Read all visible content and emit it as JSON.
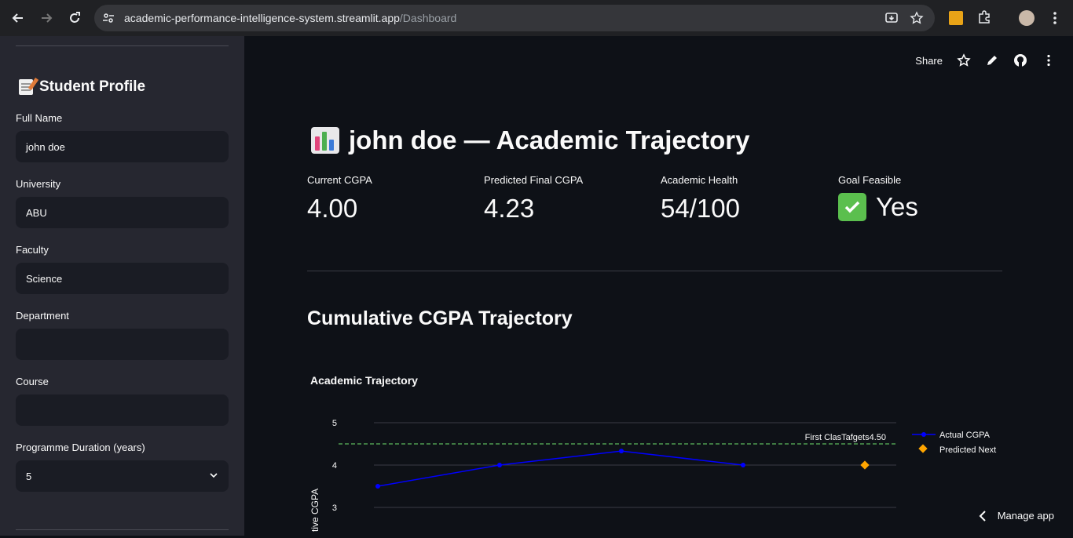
{
  "browser": {
    "url_host": "academic-performance-intelligence-system.streamlit.app",
    "url_path": "/Dashboard"
  },
  "sidebar": {
    "title": "Student Profile",
    "fields": [
      {
        "label": "Full Name",
        "value": "john doe"
      },
      {
        "label": "University",
        "value": "ABU"
      },
      {
        "label": "Faculty",
        "value": "Science"
      },
      {
        "label": "Department",
        "value": ""
      },
      {
        "label": "Course",
        "value": ""
      },
      {
        "label": "Programme Duration (years)",
        "value": "5"
      }
    ]
  },
  "toolbar": {
    "share_label": "Share"
  },
  "page": {
    "title": "john doe — Academic Trajectory",
    "section_title": "Cumulative CGPA Trajectory",
    "manage_label": "Manage app"
  },
  "metrics": [
    {
      "label": "Current CGPA",
      "value": "4.00"
    },
    {
      "label": "Predicted Final CGPA",
      "value": "4.23"
    },
    {
      "label": "Academic Health",
      "value": "54/100"
    },
    {
      "label": "Goal Feasible",
      "value": "Yes"
    }
  ],
  "colors": {
    "actual": "#0000ff",
    "predicted": "#ffa500",
    "target_line": "#5cb85c"
  },
  "chart_data": {
    "type": "line",
    "title": "Academic Trajectory",
    "ylabel": "tive CGPA",
    "yticks": [
      3,
      4,
      5
    ],
    "series": [
      {
        "name": "Actual CGPA",
        "x": [
          1,
          2,
          3,
          4
        ],
        "values": [
          3.5,
          4.0,
          4.33,
          4.0
        ]
      },
      {
        "name": "Predicted Next",
        "x": [
          5
        ],
        "values": [
          4.0
        ]
      }
    ],
    "reference_lines": [
      {
        "label": "First Class (4.50)",
        "value": 4.5
      },
      {
        "label": "Target: 4.50",
        "value": 4.5
      }
    ],
    "annotation_text": "First ClasTafgets4.50",
    "legend_position": "top-right"
  }
}
